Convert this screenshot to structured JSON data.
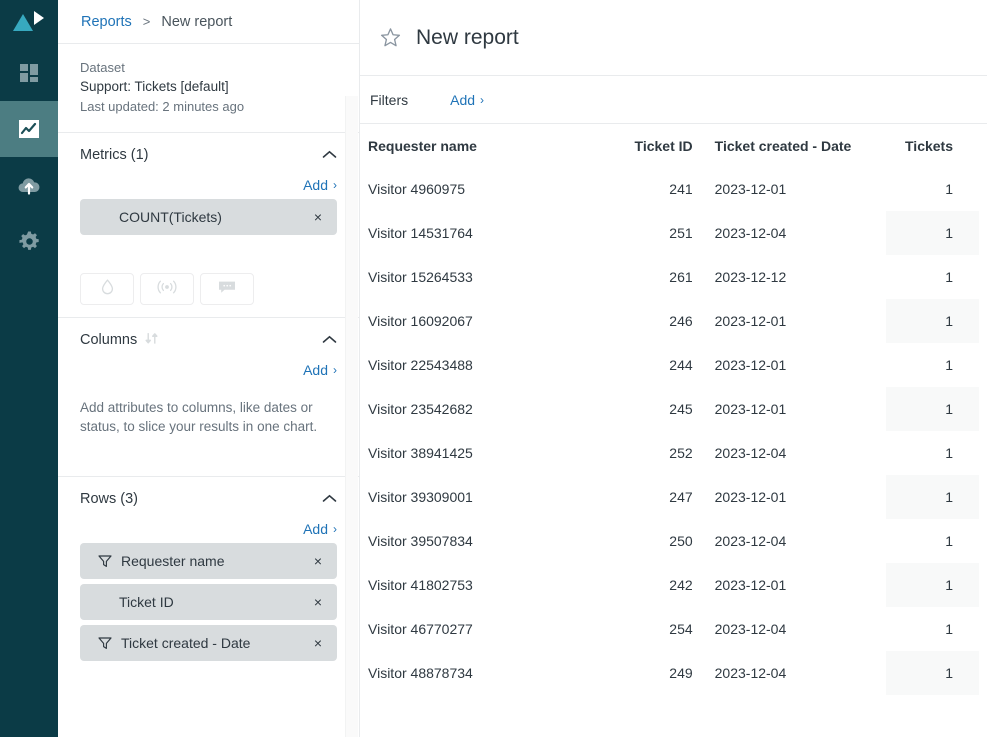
{
  "rail": {
    "logo": "logo-triangle-play",
    "items": [
      {
        "icon": "dashboard-grid-icon",
        "name": "dashboard",
        "active": false
      },
      {
        "icon": "chart-line-icon",
        "name": "explore",
        "active": true
      },
      {
        "icon": "cloud-upload-icon",
        "name": "uploads",
        "active": false
      },
      {
        "icon": "gear-icon",
        "name": "settings",
        "active": false
      }
    ]
  },
  "breadcrumb": {
    "parent": "Reports",
    "separator": ">",
    "current": "New report"
  },
  "dataset": {
    "label": "Dataset",
    "name": "Support: Tickets [default]",
    "updated": "Last updated: 2 minutes ago"
  },
  "metrics": {
    "title": "Metrics (1)",
    "add_label": "Add",
    "add_caret": "›",
    "items": [
      {
        "label": "COUNT(Tickets)",
        "remove": "×",
        "has_filter_icon": false,
        "indent": true
      }
    ],
    "tools": [
      {
        "icon": "droplet-icon",
        "name": "color-palette-button"
      },
      {
        "icon": "broadcast-icon",
        "name": "result-path-button"
      },
      {
        "icon": "comment-icon",
        "name": "annotation-button"
      }
    ]
  },
  "columns": {
    "title": "Columns",
    "swap_icon": "swap-arrows-icon",
    "add_label": "Add",
    "add_caret": "›",
    "empty_hint": "Add attributes to columns, like dates or status, to slice your results in one chart."
  },
  "rows": {
    "title": "Rows (3)",
    "add_label": "Add",
    "add_caret": "›",
    "items": [
      {
        "label": "Requester name",
        "remove": "×",
        "has_filter_icon": true,
        "indent": false
      },
      {
        "label": "Ticket ID",
        "remove": "×",
        "has_filter_icon": false,
        "indent": true
      },
      {
        "label": "Ticket created - Date",
        "remove": "×",
        "has_filter_icon": true,
        "indent": false
      }
    ]
  },
  "report": {
    "star_icon": "star-outline-icon",
    "title": "New report"
  },
  "filters": {
    "label": "Filters",
    "add_label": "Add",
    "add_caret": "›"
  },
  "chart_data": {
    "type": "table",
    "title": "New report",
    "columns": [
      "Requester name",
      "Ticket ID",
      "Ticket created - Date",
      "Tickets"
    ],
    "rows": [
      [
        "Visitor 4960975",
        "241",
        "2023-12-01",
        "1"
      ],
      [
        "Visitor 14531764",
        "251",
        "2023-12-04",
        "1"
      ],
      [
        "Visitor 15264533",
        "261",
        "2023-12-12",
        "1"
      ],
      [
        "Visitor 16092067",
        "246",
        "2023-12-01",
        "1"
      ],
      [
        "Visitor 22543488",
        "244",
        "2023-12-01",
        "1"
      ],
      [
        "Visitor 23542682",
        "245",
        "2023-12-01",
        "1"
      ],
      [
        "Visitor 38941425",
        "252",
        "2023-12-04",
        "1"
      ],
      [
        "Visitor 39309001",
        "247",
        "2023-12-01",
        "1"
      ],
      [
        "Visitor 39507834",
        "250",
        "2023-12-04",
        "1"
      ],
      [
        "Visitor 41802753",
        "242",
        "2023-12-01",
        "1"
      ],
      [
        "Visitor 46770277",
        "254",
        "2023-12-04",
        "1"
      ],
      [
        "Visitor 48878734",
        "249",
        "2023-12-04",
        "1"
      ]
    ]
  },
  "colors": {
    "rail_bg": "#0b3b46",
    "rail_active": "#4c7d82",
    "logo_teal": "#37a9bf",
    "link_blue": "#1f73b7",
    "pill_bg": "#d8dcde",
    "text": "#2f3941",
    "muted": "#68737d",
    "zebra": "#f8f9f9"
  }
}
